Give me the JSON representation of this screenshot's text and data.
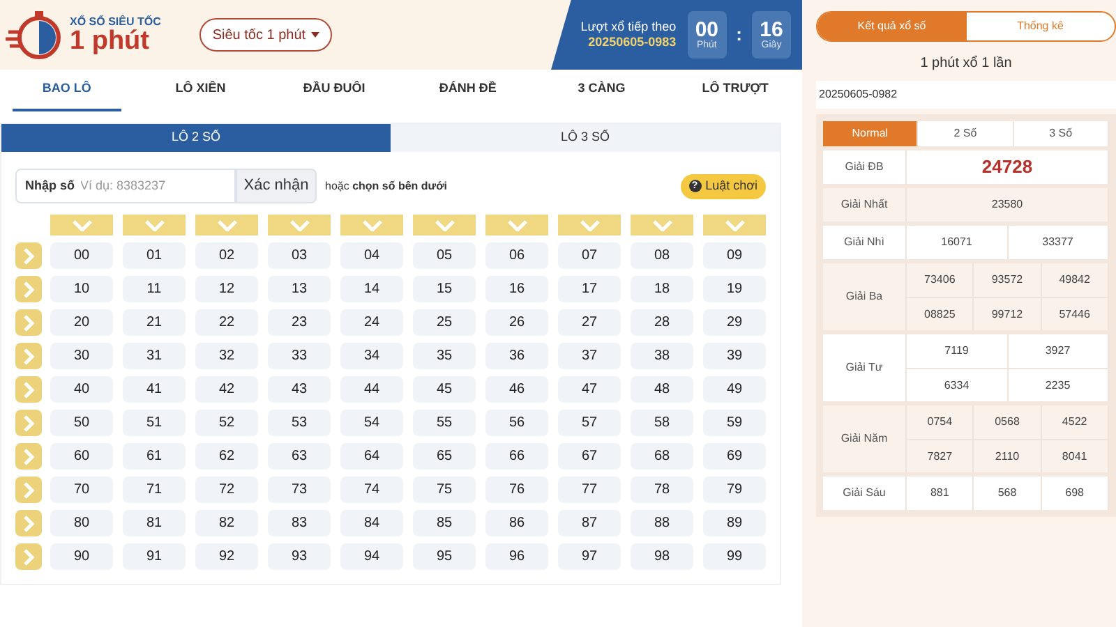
{
  "logo": {
    "small": "XỔ SỐ SIÊU TỐC",
    "big": "1 phút"
  },
  "mode_dropdown": {
    "label": "Siêu tốc 1 phút"
  },
  "countdown": {
    "label": "Lượt xổ tiếp theo",
    "draw_id": "20250605-0983",
    "minutes": "00",
    "minutes_unit": "Phút",
    "separator": ":",
    "seconds": "16",
    "seconds_unit": "Giây"
  },
  "bet_tabs": [
    {
      "label": "BAO LÔ",
      "selected": true
    },
    {
      "label": "LÔ XIÊN",
      "selected": false
    },
    {
      "label": "ĐẦU ĐUÔI",
      "selected": false
    },
    {
      "label": "ĐÁNH ĐỀ",
      "selected": false
    },
    {
      "label": "3 CÀNG",
      "selected": false
    },
    {
      "label": "LÔ TRƯỢT",
      "selected": false
    }
  ],
  "sub_tabs": [
    {
      "label": "LÔ 2 SỐ",
      "selected": true
    },
    {
      "label": "LÔ 3 SỐ",
      "selected": false
    }
  ],
  "input": {
    "label": "Nhập số",
    "placeholder": "Ví dụ: 8383237",
    "button": "Xác nhận",
    "hint": "hoặc **chọn số bên dưới**"
  },
  "rules_button": {
    "icon": "?",
    "label": "Luật chơi"
  },
  "numbers": [
    [
      "00",
      "01",
      "02",
      "03",
      "04",
      "05",
      "06",
      "07",
      "08",
      "09"
    ],
    [
      "10",
      "11",
      "12",
      "13",
      "14",
      "15",
      "16",
      "17",
      "18",
      "19"
    ],
    [
      "20",
      "21",
      "22",
      "23",
      "24",
      "25",
      "26",
      "27",
      "28",
      "29"
    ],
    [
      "30",
      "31",
      "32",
      "33",
      "34",
      "35",
      "36",
      "37",
      "38",
      "39"
    ],
    [
      "40",
      "41",
      "42",
      "43",
      "44",
      "45",
      "46",
      "47",
      "48",
      "49"
    ],
    [
      "50",
      "51",
      "52",
      "53",
      "54",
      "55",
      "56",
      "57",
      "58",
      "59"
    ],
    [
      "60",
      "61",
      "62",
      "63",
      "64",
      "65",
      "66",
      "67",
      "68",
      "69"
    ],
    [
      "70",
      "71",
      "72",
      "73",
      "74",
      "75",
      "76",
      "77",
      "78",
      "79"
    ],
    [
      "80",
      "81",
      "82",
      "83",
      "84",
      "85",
      "86",
      "87",
      "88",
      "89"
    ],
    [
      "90",
      "91",
      "92",
      "93",
      "94",
      "95",
      "96",
      "97",
      "98",
      "99"
    ]
  ],
  "results": {
    "tabs": [
      {
        "label": "Kết quả xổ số",
        "selected": true
      },
      {
        "label": "Thống kê",
        "selected": false
      }
    ],
    "title": "1 phút xổ 1 lần",
    "draw_id": "20250605-0982",
    "view_tabs": [
      {
        "label": "Normal",
        "selected": true
      },
      {
        "label": "2 Số",
        "selected": false
      },
      {
        "label": "3 Số",
        "selected": false
      }
    ],
    "prizes": [
      {
        "label": "Giải ĐB",
        "kind": "special",
        "lines": [
          [
            "24728"
          ]
        ]
      },
      {
        "label": "Giải Nhất",
        "kind": "normal",
        "lines": [
          [
            "23580"
          ]
        ]
      },
      {
        "label": "Giải Nhì",
        "kind": "normal",
        "lines": [
          [
            "16071",
            "33377"
          ]
        ]
      },
      {
        "label": "Giải Ba",
        "kind": "normal",
        "lines": [
          [
            "73406",
            "93572",
            "49842"
          ],
          [
            "08825",
            "99712",
            "57446"
          ]
        ]
      },
      {
        "label": "Giải Tư",
        "kind": "normal",
        "lines": [
          [
            "7119",
            "3927"
          ],
          [
            "6334",
            "2235"
          ]
        ]
      },
      {
        "label": "Giải Năm",
        "kind": "normal",
        "lines": [
          [
            "0754",
            "0568",
            "4522"
          ],
          [
            "7827",
            "2110",
            "8041"
          ]
        ]
      },
      {
        "label": "Giải Sáu",
        "kind": "normal",
        "lines": [
          [
            "881",
            "568",
            "698"
          ]
        ]
      }
    ]
  }
}
